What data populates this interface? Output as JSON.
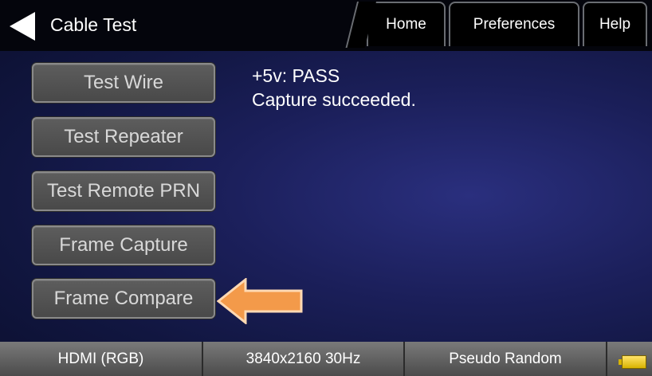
{
  "header": {
    "title": "Cable Test",
    "tabs": [
      {
        "label": "Home"
      },
      {
        "label": "Preferences"
      },
      {
        "label": "Help"
      }
    ]
  },
  "sidebar": {
    "buttons": [
      {
        "label": "Test Wire"
      },
      {
        "label": "Test Repeater"
      },
      {
        "label": "Test Remote PRN"
      },
      {
        "label": "Frame Capture"
      },
      {
        "label": "Frame Compare"
      }
    ]
  },
  "status": {
    "line1": "+5v: PASS",
    "line2": "Capture succeeded."
  },
  "footer": {
    "interface": "HDMI (RGB)",
    "resolution": "3840x2160 30Hz",
    "pattern": "Pseudo Random"
  },
  "colors": {
    "arrow": "#f39a4a",
    "battery": "#f2cc1f",
    "background": "#1b1f5a"
  }
}
